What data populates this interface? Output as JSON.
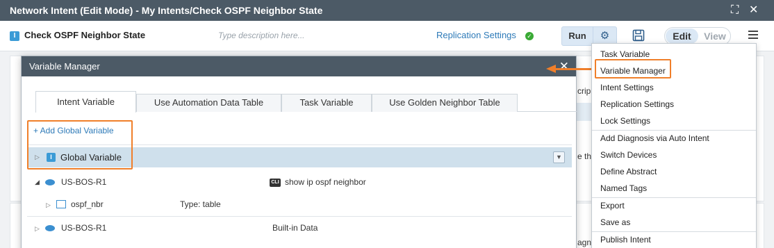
{
  "window": {
    "title": "Network Intent (Edit Mode) - My Intents/Check OSPF Neighbor State"
  },
  "toolbar": {
    "intent_name": "Check OSPF Neighbor State",
    "description_placeholder": "Type description here...",
    "replication_label": "Replication Settings",
    "run_label": "Run",
    "edit_label": "Edit",
    "view_label": "View",
    "mode": "Edit"
  },
  "background": {
    "frag1": "cripl",
    "frag2": "e th",
    "frag3": "agn"
  },
  "dialog": {
    "title": "Variable Manager",
    "tabs": [
      {
        "label": "Intent Variable",
        "active": true
      },
      {
        "label": "Use Automation Data Table",
        "active": false
      },
      {
        "label": "Task Variable",
        "active": false
      },
      {
        "label": "Use Golden Neighbor Table",
        "active": false
      }
    ],
    "add_global_label": "+ Add Global Variable",
    "global_variable_label": "Global Variable",
    "rows": [
      {
        "device": "US-BOS-R1",
        "source_tag": "CLI",
        "source": "show ip ospf neighbor",
        "expanded": true,
        "children": [
          {
            "name": "ospf_nbr",
            "type": "Type: table"
          }
        ]
      },
      {
        "device": "US-BOS-R1",
        "source": "Built-in Data",
        "expanded": false
      }
    ]
  },
  "menu": {
    "items": [
      "Task Variable",
      "Variable Manager",
      "Intent Settings",
      "Replication Settings",
      "Lock Settings",
      "Add Diagnosis via Auto Intent",
      "Switch Devices",
      "Define Abstract",
      "Named Tags",
      "Export",
      "Save as",
      "Publish Intent"
    ],
    "highlighted": "Variable Manager"
  },
  "colors": {
    "accent": "#f07f2a",
    "titlebar": "#4c5a66",
    "link": "#2d7ab8",
    "selected_row": "#cfe0ec",
    "status_ok": "#3aaa35"
  },
  "icons": [
    "maximize-icon",
    "close-icon",
    "intent-icon",
    "check-circle-icon",
    "gear-icon",
    "save-icon",
    "hamburger-menu-icon",
    "device-icon",
    "cli-icon",
    "table-icon",
    "expand-caret-icon",
    "dropdown-icon"
  ]
}
